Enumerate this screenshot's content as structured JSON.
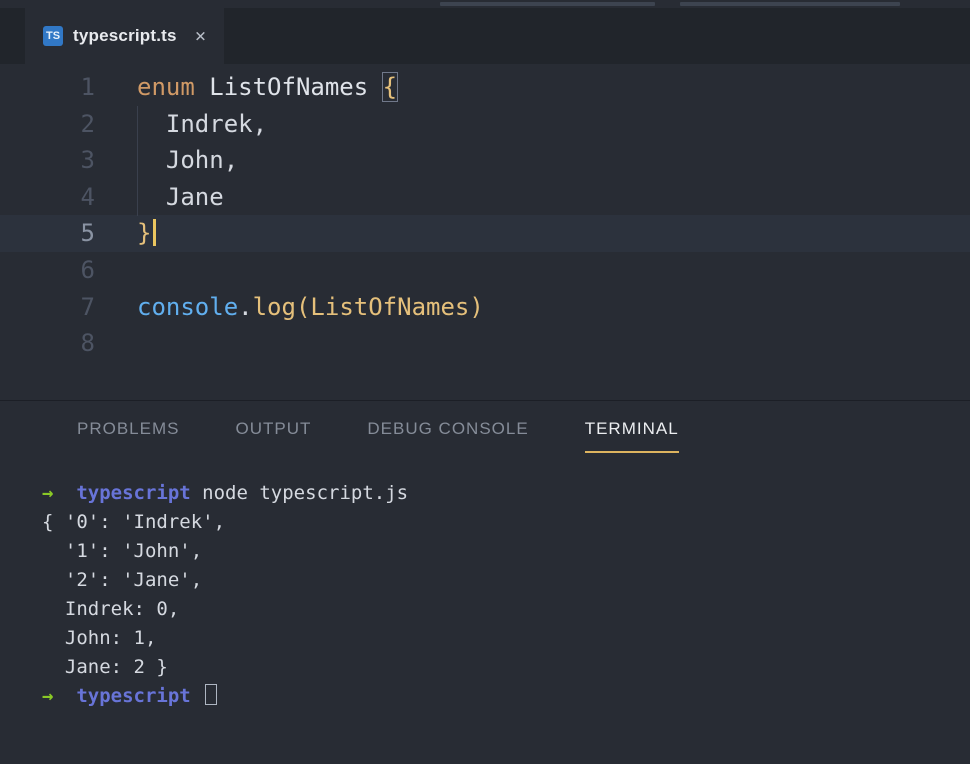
{
  "window": {
    "tab": {
      "icon": "TS",
      "label": "typescript.ts",
      "close_glyph": "×"
    }
  },
  "editor": {
    "lines": [
      {
        "num": "1",
        "tokens": [
          {
            "c": "kw",
            "t": "enum"
          },
          {
            "c": "plain",
            "t": " "
          },
          {
            "c": "ident",
            "t": "ListOfNames"
          },
          {
            "c": "plain",
            "t": " "
          },
          {
            "c": "brace-match",
            "t": "{"
          }
        ]
      },
      {
        "num": "2",
        "tokens": [
          {
            "c": "plain",
            "t": "  Indrek,"
          }
        ]
      },
      {
        "num": "3",
        "tokens": [
          {
            "c": "plain",
            "t": "  John,"
          }
        ]
      },
      {
        "num": "4",
        "tokens": [
          {
            "c": "plain",
            "t": "  Jane"
          }
        ]
      },
      {
        "num": "5",
        "active": true,
        "cursor": true,
        "tokens": [
          {
            "c": "brace",
            "t": "}"
          }
        ]
      },
      {
        "num": "6",
        "tokens": []
      },
      {
        "num": "7",
        "tokens": [
          {
            "c": "builtin",
            "t": "console"
          },
          {
            "c": "plain",
            "t": "."
          },
          {
            "c": "fn",
            "t": "log"
          },
          {
            "c": "fn",
            "t": "("
          },
          {
            "c": "fn",
            "t": "ListOfNames"
          },
          {
            "c": "fn",
            "t": ")"
          }
        ]
      },
      {
        "num": "8",
        "tokens": []
      }
    ]
  },
  "panel": {
    "tabs": [
      {
        "label": "PROBLEMS",
        "active": false
      },
      {
        "label": "OUTPUT",
        "active": false
      },
      {
        "label": "DEBUG CONSOLE",
        "active": false
      },
      {
        "label": "TERMINAL",
        "active": true
      }
    ]
  },
  "terminal": {
    "lines": [
      {
        "tokens": [
          {
            "c": "green",
            "t": "→"
          },
          {
            "c": "plain",
            "t": "  "
          },
          {
            "c": "blue",
            "t": "typescript"
          },
          {
            "c": "plain",
            "t": " node typescript.js"
          }
        ]
      },
      {
        "tokens": [
          {
            "c": "plain",
            "t": "{ '0': 'Indrek',"
          }
        ]
      },
      {
        "tokens": [
          {
            "c": "plain",
            "t": "  '1': 'John',"
          }
        ]
      },
      {
        "tokens": [
          {
            "c": "plain",
            "t": "  '2': 'Jane',"
          }
        ]
      },
      {
        "tokens": [
          {
            "c": "plain",
            "t": "  Indrek: 0,"
          }
        ]
      },
      {
        "tokens": [
          {
            "c": "plain",
            "t": "  John: 1,"
          }
        ]
      },
      {
        "tokens": [
          {
            "c": "plain",
            "t": "  Jane: 2 }"
          }
        ]
      },
      {
        "tokens": [
          {
            "c": "green",
            "t": "→"
          },
          {
            "c": "plain",
            "t": "  "
          },
          {
            "c": "blue",
            "t": "typescript"
          },
          {
            "c": "plain",
            "t": " "
          },
          {
            "c": "cursor",
            "t": ""
          }
        ]
      }
    ]
  },
  "colors": {
    "editor_background": "#282c34",
    "tabbar_background": "#21252b",
    "current_line_background": "#2c323d",
    "keyword_orange": "#d19a66",
    "brace_gold": "#e5c07b",
    "builtin_blue": "#61afef",
    "text": "#d5d9e0",
    "line_number": "#4d5463",
    "editor_cursor_gold": "#eac55f",
    "panel_tab_underline": "#ddb45f",
    "prompt_arrow_green": "#8ac926",
    "prompt_dir_blue": "#6874d8",
    "ts_icon_blue": "#3178c6"
  }
}
